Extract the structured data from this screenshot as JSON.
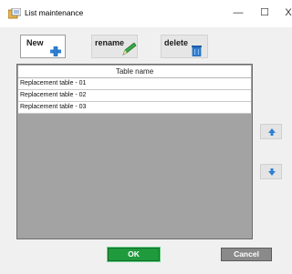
{
  "window": {
    "title": "List maintenance",
    "icon": "app-icon",
    "controls": {
      "minimize": "—",
      "maximize": "☐",
      "close": "X"
    }
  },
  "toolbar": {
    "new_label": "New",
    "new_icon": "add-icon",
    "rename_label": "rename",
    "rename_icon": "pencil-icon",
    "delete_label": "delete",
    "delete_icon": "trash-icon"
  },
  "table": {
    "header": "Table name",
    "rows": [
      "Replacement table - 01",
      "Replacement table - 02",
      "Replacement table - 03"
    ]
  },
  "reorder": {
    "up_icon": "arrow-up-icon",
    "down_icon": "arrow-down-icon"
  },
  "footer": {
    "ok_label": "OK",
    "cancel_label": "Cancel"
  },
  "colors": {
    "ok_button": "#1f9a3d",
    "cancel_button": "#8a8a8a",
    "list_background": "#a3a3a3",
    "arrow_blue": "#2f7fd3"
  }
}
